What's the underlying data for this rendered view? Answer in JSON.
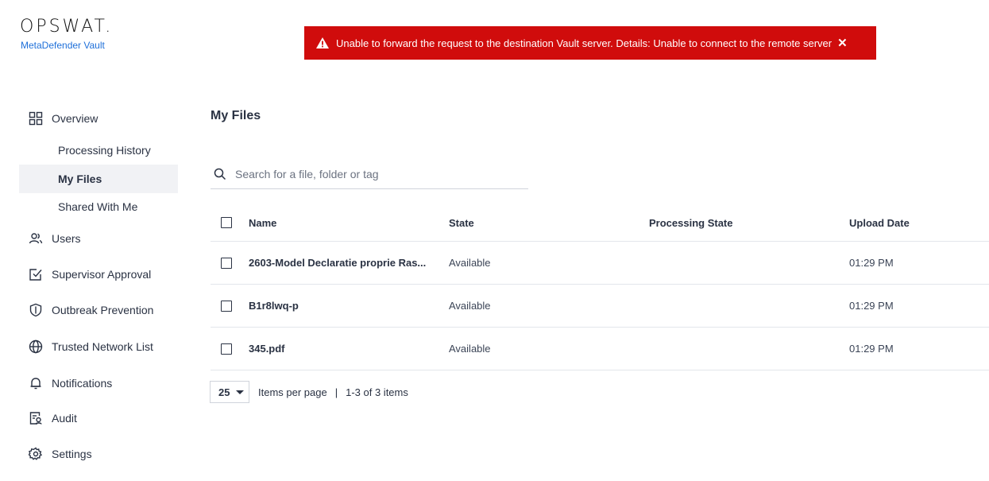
{
  "brand": {
    "name": "OPSWAT.",
    "product": "MetaDefender Vault"
  },
  "alert": {
    "message": "Unable to forward the request to the destination Vault server. Details: Unable to connect to the remote server",
    "close": "✕",
    "color": "#d00c0c"
  },
  "nav": {
    "overview": "Overview",
    "processing_history": "Processing History",
    "my_files": "My Files",
    "shared_with_me": "Shared With Me",
    "users": "Users",
    "supervisor_approval": "Supervisor Approval",
    "outbreak_prevention": "Outbreak Prevention",
    "trusted_network_list": "Trusted Network List",
    "notifications": "Notifications",
    "audit": "Audit",
    "settings": "Settings"
  },
  "page": {
    "title": "My Files"
  },
  "search": {
    "placeholder": "Search for a file, folder or tag",
    "value": ""
  },
  "table": {
    "headers": {
      "name": "Name",
      "state": "State",
      "processing_state": "Processing State",
      "upload_date": "Upload Date"
    },
    "rows": [
      {
        "name": "2603-Model Declaratie proprie Ras...",
        "state": "Available",
        "processing_state": "",
        "upload_date": "01:29 PM"
      },
      {
        "name": "B1r8lwq-p",
        "state": "Available",
        "processing_state": "",
        "upload_date": "01:29 PM"
      },
      {
        "name": "345.pdf",
        "state": "Available",
        "processing_state": "",
        "upload_date": "01:29 PM"
      }
    ]
  },
  "pagination": {
    "per_page": "25",
    "per_page_label": "Items per page",
    "separator": "|",
    "range": "1-3 of 3 items"
  }
}
